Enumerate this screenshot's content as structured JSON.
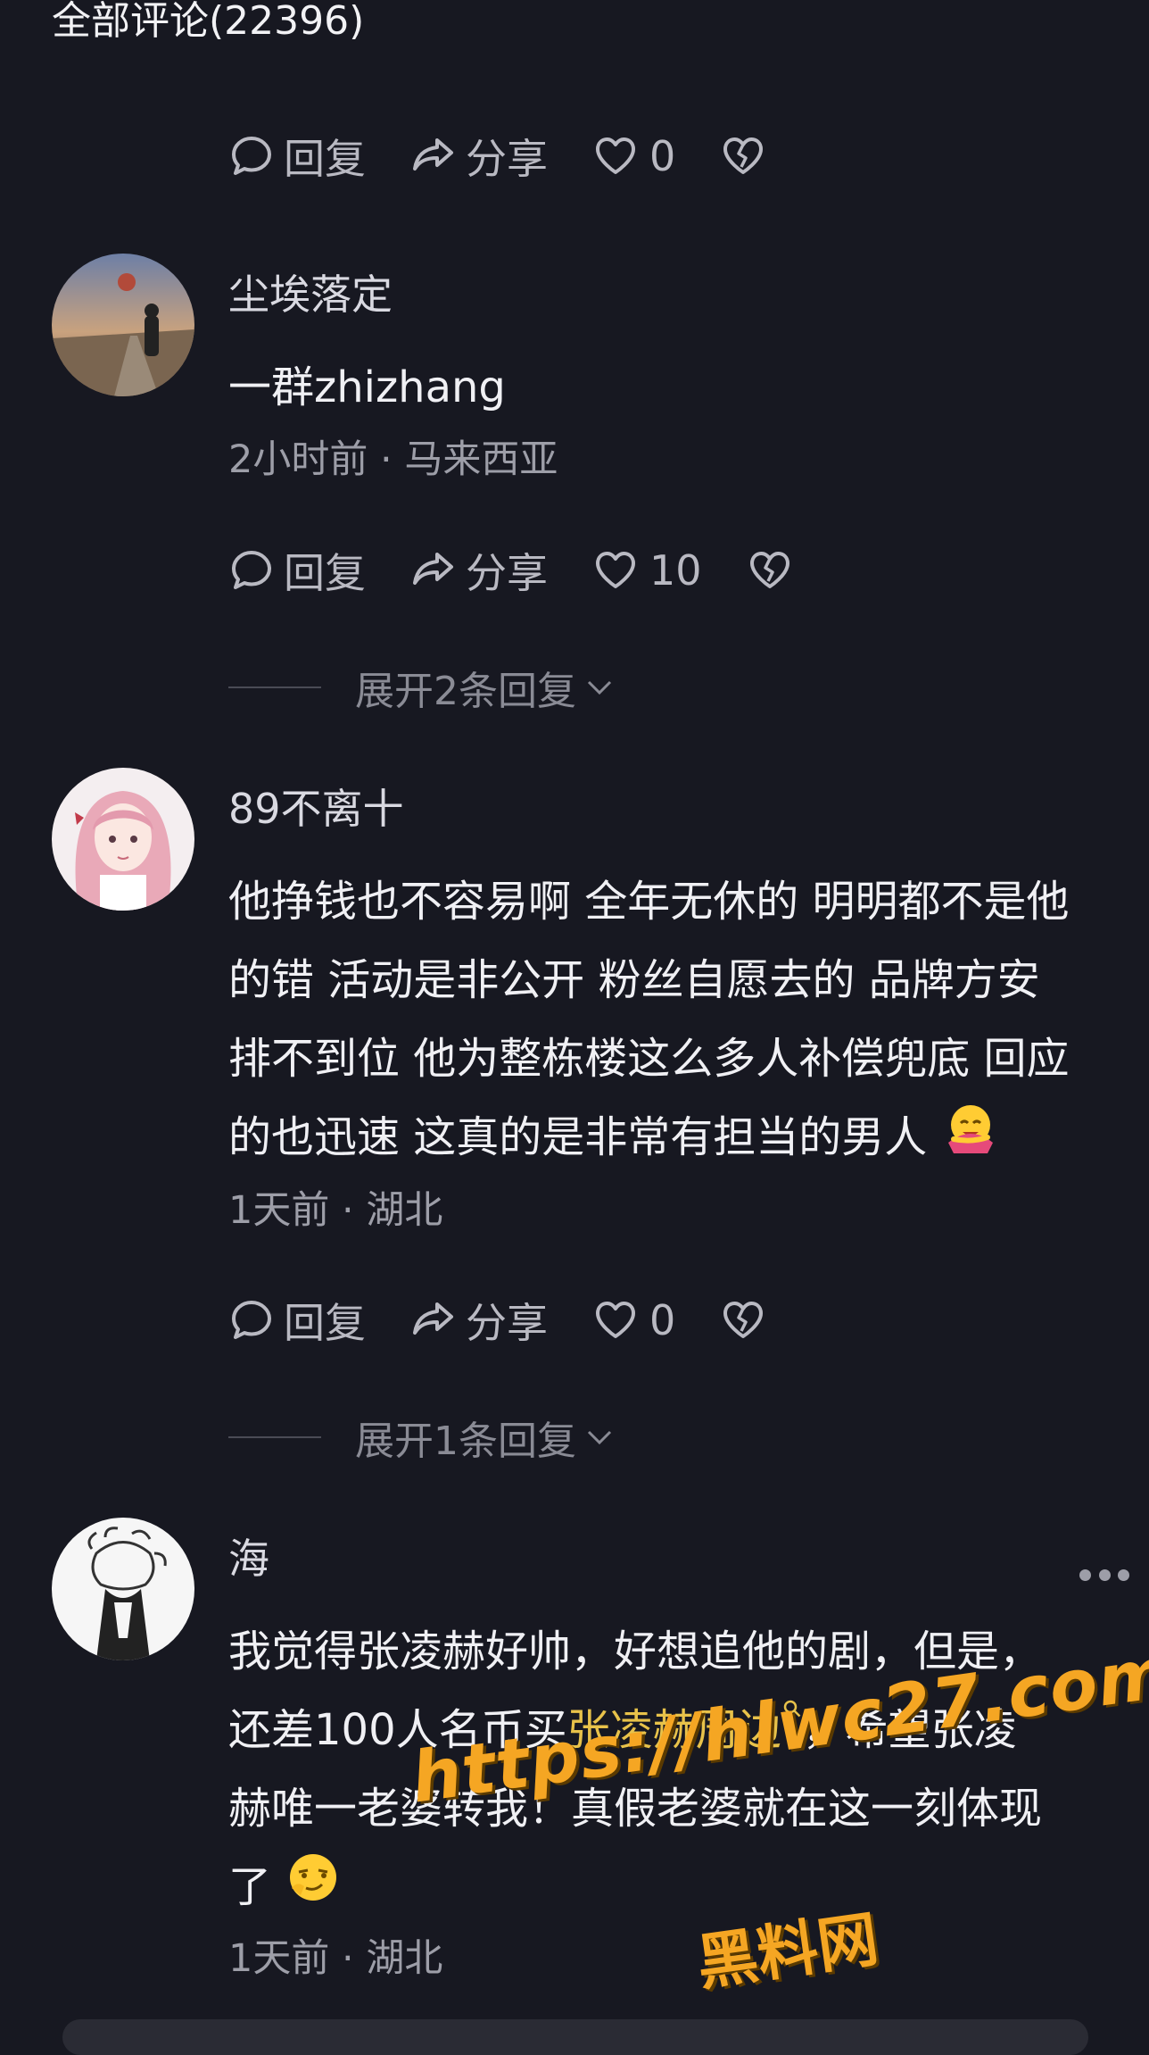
{
  "header": {
    "title": "全部评论(22396)"
  },
  "icons": {
    "reply": "comment-bubble-icon",
    "share": "share-arrow-icon",
    "like": "heart-icon",
    "dislike": "broken-heart-icon",
    "expand": "chevron-down-icon",
    "more": "more-dots-icon"
  },
  "labels": {
    "reply": "回复",
    "share": "分享"
  },
  "top_actions": {
    "likes": "0"
  },
  "comments": [
    {
      "username": "尘埃落定",
      "text": "一群zhizhang",
      "meta": "2小时前 · 马来西亚",
      "likes": "10",
      "expand": "展开2条回复"
    },
    {
      "username": "89不离十",
      "text_line1": "他挣钱也不容易啊 全年无休的 明明都不是他",
      "text_line2": "的错 活动是非公开 粉丝自愿去的 品牌方安",
      "text_line3": "排不到位 他为整栋楼这么多人补偿兜底 回应",
      "text_line4": "的也迅速 这真的是非常有担当的男人",
      "meta": "1天前 · 湖北",
      "likes": "0",
      "expand": "展开1条回复"
    },
    {
      "username": "海",
      "text_line1": "我觉得张凌赫好帅，好想追他的剧，但是，",
      "text_line2_a": "还差100人名币买",
      "text_line2_link": "张凌赫周边",
      "text_line2_b": "，希望张凌",
      "text_line3": "赫唯一老婆转我！真假老婆就在这一刻体现",
      "text_line4": "了",
      "meta": "1天前 · 湖北"
    }
  ],
  "watermark": {
    "url": "https://hlwc27.com",
    "name": "黑料网"
  },
  "colors": {
    "background": "#171821",
    "link": "#e8c24a",
    "watermark": "#f5a623"
  }
}
